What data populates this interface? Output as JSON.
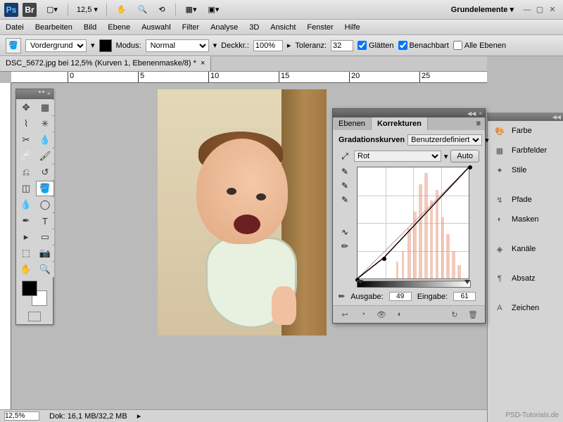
{
  "titlebar": {
    "zoom": "12,5",
    "workspace": "Grundelemente"
  },
  "menu": [
    "Datei",
    "Bearbeiten",
    "Bild",
    "Ebene",
    "Auswahl",
    "Filter",
    "Analyse",
    "3D",
    "Ansicht",
    "Fenster",
    "Hilfe"
  ],
  "options": {
    "fill": "Vordergrund",
    "mode_label": "Modus:",
    "mode": "Normal",
    "opacity_label": "Deckkr.:",
    "opacity": "100%",
    "tolerance_label": "Toleranz:",
    "tolerance": "32",
    "antialias": "Glätten",
    "contiguous": "Benachbart",
    "all_layers": "Alle Ebenen"
  },
  "tab": "DSC_5672.jpg bei 12,5% (Kurven 1, Ebenenmaske/8) *",
  "ruler_ticks": [
    "0",
    "5",
    "10",
    "15",
    "20",
    "25"
  ],
  "status": {
    "zoom": "12,5%",
    "doc_label": "Dok:",
    "doc": "16,1 MB/32,2 MB"
  },
  "right_dock": {
    "items": [
      "Farbe",
      "Farbfelder",
      "Stile",
      "Pfade",
      "Masken",
      "Kanäle",
      "Absatz",
      "Zeichen"
    ]
  },
  "curves": {
    "tab1": "Ebenen",
    "tab2": "Korrekturen",
    "title": "Gradationskurven",
    "preset": "Benutzerdefiniert",
    "channel": "Rot",
    "auto": "Auto",
    "output_label": "Ausgabe:",
    "output": "49",
    "input_label": "Eingabe:",
    "input": "61"
  },
  "watermark": "PSD-Tutorials.de"
}
